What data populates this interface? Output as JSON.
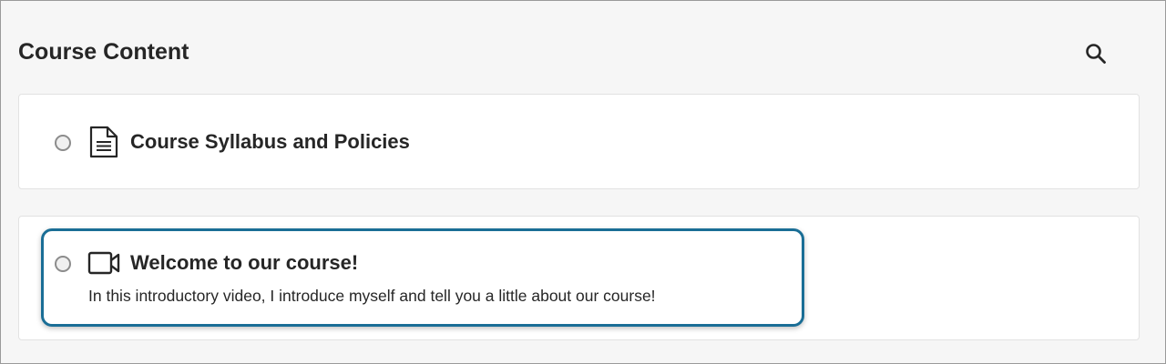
{
  "header": {
    "title": "Course Content",
    "search_icon": "search-icon"
  },
  "items": [
    {
      "title": "Course Syllabus and Policies",
      "icon": "document-icon",
      "description": ""
    },
    {
      "title": "Welcome to our course!",
      "icon": "video-icon",
      "description": "In this introductory video, I introduce myself and tell you a little about our course!"
    }
  ],
  "colors": {
    "highlight_border": "#1a6e96",
    "background": "#f6f6f6",
    "card": "#ffffff"
  }
}
